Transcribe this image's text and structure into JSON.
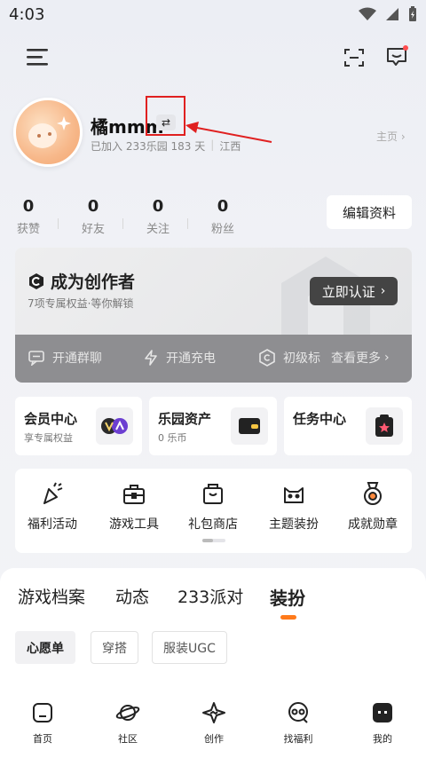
{
  "status_bar": {
    "time": "4:03"
  },
  "profile": {
    "username": "橘mmm",
    "switch_symbol": "⇄",
    "joined_text": "已加入 233乐园 183 天",
    "location": "江西",
    "homepage_link": "主页"
  },
  "stats": [
    {
      "value": "0",
      "label": "获赞"
    },
    {
      "value": "0",
      "label": "好友"
    },
    {
      "value": "0",
      "label": "关注"
    },
    {
      "value": "0",
      "label": "粉丝"
    }
  ],
  "edit_profile_label": "编辑资料",
  "creator": {
    "title": "成为创作者",
    "subtitle": "7项专属权益·等你解锁",
    "verify_label": "立即认证",
    "perks": [
      "开通群聊",
      "开通充电",
      "初级标"
    ],
    "see_more": "查看更多"
  },
  "quick_cards": [
    {
      "title": "会员中心",
      "subtitle": "享专属权益"
    },
    {
      "title": "乐园资产",
      "subtitle": "0 乐币"
    },
    {
      "title": "任务中心",
      "subtitle": ""
    }
  ],
  "tools": [
    {
      "label": "福利活动"
    },
    {
      "label": "游戏工具"
    },
    {
      "label": "礼包商店"
    },
    {
      "label": "主题装扮"
    },
    {
      "label": "成就勋章"
    }
  ],
  "content_tabs": [
    "游戏档案",
    "动态",
    "233派对",
    "装扮"
  ],
  "active_content_tab": "装扮",
  "chips": [
    "心愿单",
    "穿搭",
    "服装UGC"
  ],
  "bottom_nav": [
    {
      "label": "首页"
    },
    {
      "label": "社区"
    },
    {
      "label": "创作"
    },
    {
      "label": "找福利"
    },
    {
      "label": "我的"
    }
  ],
  "colors": {
    "accent": "#ff7a1a",
    "annotation": "#e02020"
  }
}
